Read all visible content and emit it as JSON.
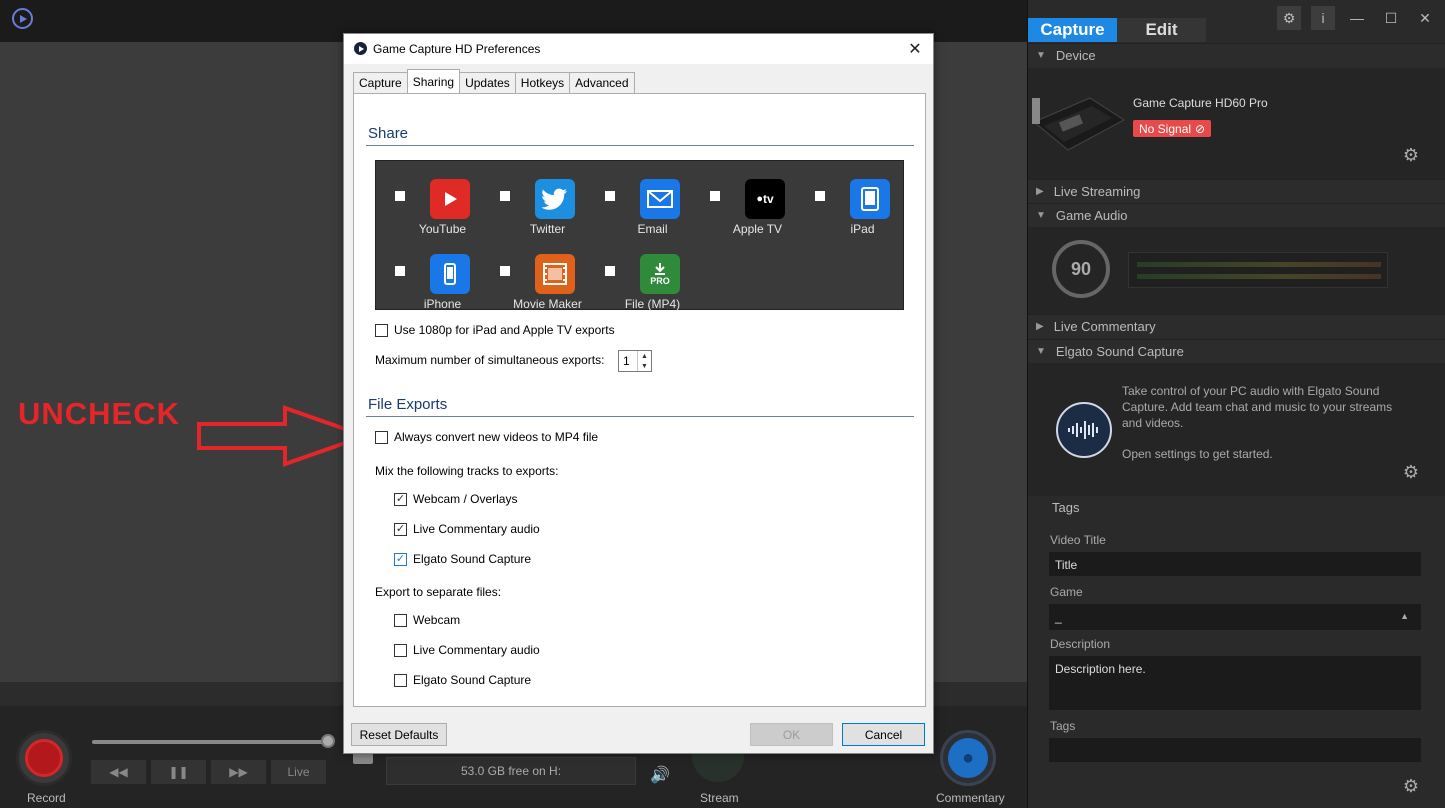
{
  "app": {
    "storage_text": "53.0 GB free on H:",
    "bottom": {
      "record_label": "Record",
      "stream_label": "Stream",
      "commentary_label": "Commentary",
      "rewind_label": "◀◀",
      "pause_label": "❚❚",
      "forward_label": "▶▶",
      "live_label": "Live"
    }
  },
  "annotation": {
    "text": "UNCHECK",
    "color": "#e4262b"
  },
  "right_panel": {
    "tabs": [
      "Capture",
      "Edit"
    ],
    "device_section": "Device",
    "device_name": "Game Capture HD60 Pro",
    "no_signal": "No Signal",
    "live_streaming": "Live Streaming",
    "game_audio": "Game Audio",
    "audio_level": "90",
    "live_commentary": "Live Commentary",
    "esc_section": "Elgato Sound Capture",
    "esc_text": "Take control of your PC audio with Elgato Sound Capture. Add team chat and music to your streams and videos.",
    "esc_hint": "Open settings to get started.",
    "tags_header": "Tags",
    "video_title_label": "Video Title",
    "video_title_value": "Title",
    "game_label": "Game",
    "game_value": "_",
    "description_label": "Description",
    "description_value": "Description here.",
    "tags_label": "Tags",
    "tags_value": ""
  },
  "dialog": {
    "title": "Game Capture HD Preferences",
    "tabs": [
      "Capture",
      "Sharing",
      "Updates",
      "Hotkeys",
      "Advanced"
    ],
    "active_tab": "Sharing",
    "share_title": "Share",
    "share_items": [
      {
        "label": "YouTube",
        "color": "#e02a26"
      },
      {
        "label": "Twitter",
        "color": "#1d8fe0"
      },
      {
        "label": "Email",
        "color": "#1a77e8"
      },
      {
        "label": "Apple TV",
        "color": "#000000"
      },
      {
        "label": "iPad",
        "color": "#1a77e8"
      },
      {
        "label": "iPhone",
        "color": "#1a77e8"
      },
      {
        "label": "Movie Maker",
        "color": "#e0621a"
      },
      {
        "label": "File (MP4)",
        "color": "#2f8a3a"
      }
    ],
    "apple_tv_text": "tv",
    "pro_text": "PRO",
    "use_1080p": "Use 1080p for iPad and Apple TV exports",
    "max_exports_label": "Maximum number of simultaneous exports:",
    "max_exports_value": "1",
    "file_exports_title": "File Exports",
    "always_convert": "Always convert new videos to MP4 file",
    "mix_tracks_label": "Mix the following tracks to exports:",
    "mix_tracks": [
      {
        "label": "Webcam / Overlays",
        "checked": true
      },
      {
        "label": "Live Commentary audio",
        "checked": true
      },
      {
        "label": "Elgato Sound Capture",
        "checked": true
      }
    ],
    "separate_label": "Export to separate files:",
    "separate_tracks": [
      {
        "label": "Webcam",
        "checked": false
      },
      {
        "label": "Live Commentary audio",
        "checked": false
      },
      {
        "label": "Elgato Sound Capture",
        "checked": false
      }
    ],
    "buttons": {
      "reset": "Reset Defaults",
      "ok": "OK",
      "cancel": "Cancel"
    }
  }
}
